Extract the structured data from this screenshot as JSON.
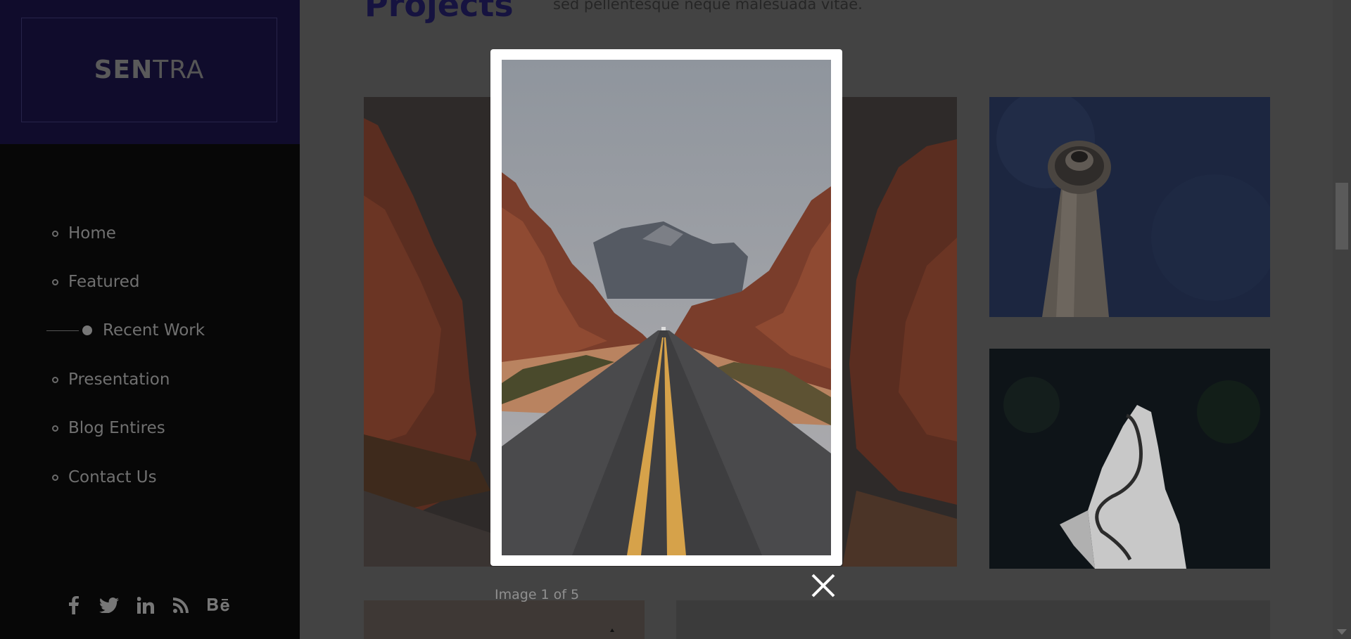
{
  "brand": {
    "bold": "SEN",
    "light": "TRA"
  },
  "nav": {
    "items": [
      {
        "label": "Home",
        "active": false
      },
      {
        "label": "Featured",
        "active": false
      },
      {
        "label": "Recent Work",
        "active": true
      },
      {
        "label": "Presentation",
        "active": false
      },
      {
        "label": "Blog Entires",
        "active": false
      },
      {
        "label": "Contact Us",
        "active": false
      }
    ]
  },
  "social": [
    "facebook-icon",
    "twitter-icon",
    "linkedin-icon",
    "rss-icon",
    "behance-icon"
  ],
  "section": {
    "title": "Projects",
    "intro": "sed pellentesque neque malesuada vitae."
  },
  "lightbox": {
    "caption": "Image 1 of 5",
    "close_icon": "close-icon"
  }
}
